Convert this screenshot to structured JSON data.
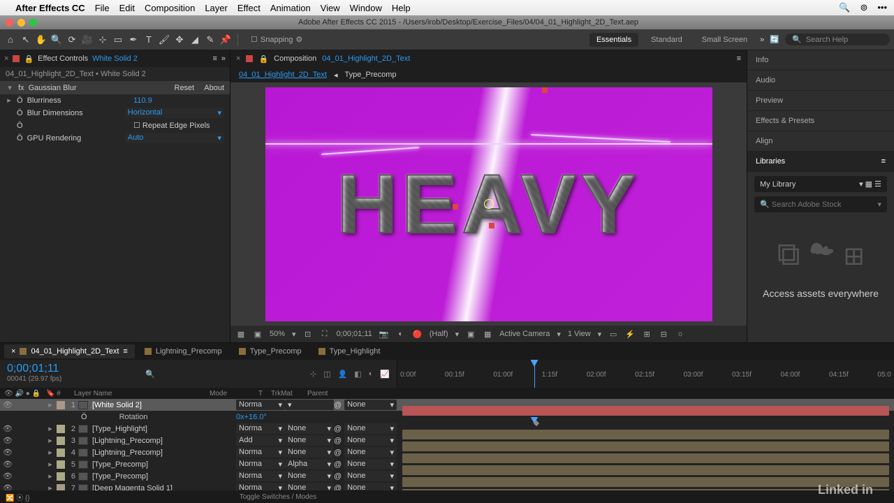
{
  "menubar": {
    "app": "After Effects CC",
    "items": [
      "File",
      "Edit",
      "Composition",
      "Layer",
      "Effect",
      "Animation",
      "View",
      "Window",
      "Help"
    ]
  },
  "titlebar": "Adobe After Effects CC 2015 - /Users/irob/Desktop/Exercise_Files/04/04_01_Highlight_2D_Text.aep",
  "toolbar": {
    "snapping": "Snapping",
    "workspaces": [
      "Essentials",
      "Standard",
      "Small Screen"
    ],
    "search_placeholder": "Search Help"
  },
  "effect_controls": {
    "panel_label": "Effect Controls",
    "layer": "White Solid 2",
    "path": "04_01_Highlight_2D_Text • White Solid 2",
    "effect": "Gaussian Blur",
    "reset": "Reset",
    "about": "About",
    "props": [
      {
        "name": "Blurriness",
        "val": "110.9"
      },
      {
        "name": "Blur Dimensions",
        "val": "Horizontal",
        "dropdown": true
      },
      {
        "name": "",
        "val": "Repeat Edge Pixels",
        "checkbox": true
      },
      {
        "name": "GPU Rendering",
        "val": "Auto",
        "dropdown": true
      }
    ]
  },
  "comp_panel": {
    "label": "Composition",
    "name": "04_01_Highlight_2D_Text",
    "breadcrumbs": [
      "04_01_Highlight_2D_Text",
      "Type_Precomp"
    ],
    "text": "HEAVY",
    "status": {
      "zoom": "50%",
      "time": "0;00;01;11",
      "res": "(Half)",
      "camera": "Active Camera",
      "view": "1 View"
    }
  },
  "right": {
    "items": [
      "Info",
      "Audio",
      "Preview",
      "Effects & Presets",
      "Align",
      "Libraries"
    ],
    "library": "My Library",
    "search": "Search Adobe Stock",
    "cc_msg": "Access assets everywhere"
  },
  "timeline": {
    "tabs": [
      "04_01_Highlight_2D_Text",
      "Lightning_Precomp",
      "Type_Precomp",
      "Type_Highlight"
    ],
    "timecode": "0;00;01;11",
    "frames": "00041 (29.97 fps)",
    "ruler": [
      "0:00f",
      "00:15f",
      "01:00f",
      "1:15f",
      "02:00f",
      "02:15f",
      "03:00f",
      "03:15f",
      "04:00f",
      "04:15f",
      "05:0"
    ],
    "cols": {
      "layername": "Layer Name",
      "mode": "Mode",
      "t": "T",
      "trkmat": "TrkMat",
      "parent": "Parent"
    },
    "layers": [
      {
        "num": 1,
        "name": "[White Solid 2]",
        "mode": "Norma",
        "trk": "",
        "parent": "None",
        "color": "#a98",
        "sel": true,
        "bar": "#b95555"
      },
      {
        "prop": true,
        "name": "Rotation",
        "val": "0x+16.0°"
      },
      {
        "num": 2,
        "name": "[Type_Highlight]",
        "mode": "Norma",
        "trk": "None",
        "parent": "None",
        "color": "#aa8"
      },
      {
        "num": 3,
        "name": "[Lightning_Precomp]",
        "mode": "Add",
        "trk": "None",
        "parent": "None",
        "color": "#aa8"
      },
      {
        "num": 4,
        "name": "[Lightning_Precomp]",
        "mode": "Norma",
        "trk": "None",
        "parent": "None",
        "color": "#aa8"
      },
      {
        "num": 5,
        "name": "[Type_Precomp]",
        "mode": "Norma",
        "trk": "Alpha",
        "parent": "None",
        "color": "#aa8"
      },
      {
        "num": 6,
        "name": "[Type_Precomp]",
        "mode": "Norma",
        "trk": "None",
        "parent": "None",
        "color": "#aa8"
      },
      {
        "num": 7,
        "name": "[Deep Magenta Solid 1]",
        "mode": "Norma",
        "trk": "None",
        "parent": "None",
        "color": "#a98"
      }
    ],
    "toggle": "Toggle Switches / Modes"
  },
  "watermark": "Linked in"
}
